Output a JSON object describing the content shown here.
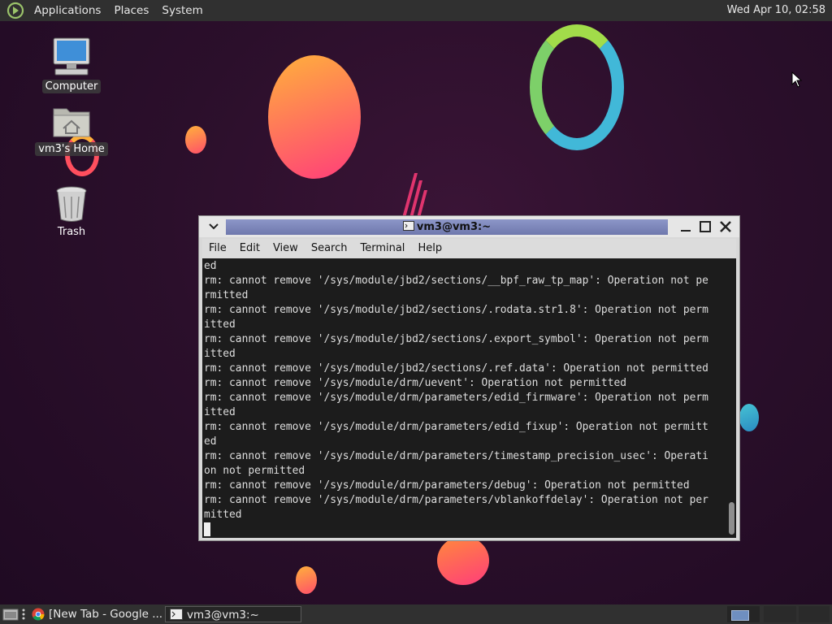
{
  "top_panel": {
    "menus": [
      "Applications",
      "Places",
      "System"
    ],
    "clock": "Wed Apr 10, 02:58"
  },
  "desktop": {
    "icons": [
      {
        "label": "Computer",
        "icon": "computer-icon"
      },
      {
        "label": "vm3's Home",
        "icon": "home-folder-icon"
      },
      {
        "label": "Trash",
        "icon": "trash-icon"
      }
    ]
  },
  "terminal": {
    "title": "vm3@vm3:~",
    "menu": [
      "File",
      "Edit",
      "View",
      "Search",
      "Terminal",
      "Help"
    ],
    "output": [
      "ed",
      "rm: cannot remove '/sys/module/jbd2/sections/__bpf_raw_tp_map': Operation not pe",
      "rmitted",
      "rm: cannot remove '/sys/module/jbd2/sections/.rodata.str1.8': Operation not perm",
      "itted",
      "rm: cannot remove '/sys/module/jbd2/sections/.export_symbol': Operation not perm",
      "itted",
      "rm: cannot remove '/sys/module/jbd2/sections/.ref.data': Operation not permitted",
      "rm: cannot remove '/sys/module/drm/uevent': Operation not permitted",
      "rm: cannot remove '/sys/module/drm/parameters/edid_firmware': Operation not perm",
      "itted",
      "rm: cannot remove '/sys/module/drm/parameters/edid_fixup': Operation not permitt",
      "ed",
      "rm: cannot remove '/sys/module/drm/parameters/timestamp_precision_usec': Operati",
      "on not permitted",
      "rm: cannot remove '/sys/module/drm/parameters/debug': Operation not permitted",
      "rm: cannot remove '/sys/module/drm/parameters/vblankoffdelay': Operation not per",
      "mitted"
    ]
  },
  "bottom_panel": {
    "tasks": [
      {
        "label": "[New Tab - Google ...",
        "icon": "chrome-icon"
      },
      {
        "label": "vm3@vm3:~",
        "icon": "terminal-icon"
      }
    ]
  },
  "colors": {
    "panel": "#303030",
    "desktop_bg": "#2b0f2b",
    "title_active": "#7b84b8",
    "terminal_bg": "#1c1c1c"
  }
}
